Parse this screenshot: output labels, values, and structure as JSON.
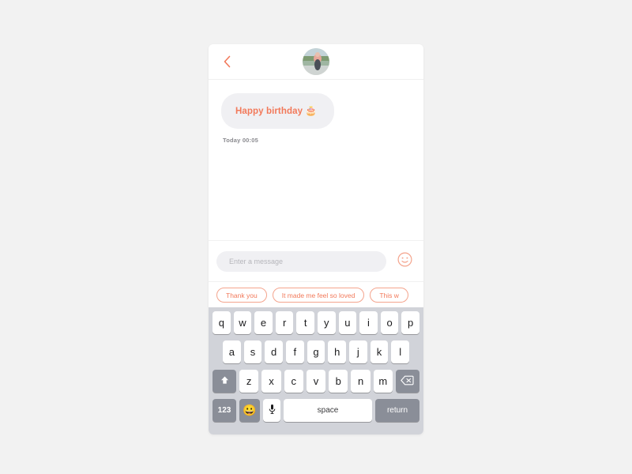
{
  "page": {
    "background_color": "#f2f2f2",
    "accent_color": "#f2795a"
  },
  "header": {
    "back_icon": "chevron-left-icon",
    "avatar_alt": "contact-avatar-photo"
  },
  "chat": {
    "messages": [
      {
        "text": "Happy birthday",
        "emoji": "🎂",
        "sender": "incoming",
        "bubble_color": "#f0f0f3",
        "text_color": "#f2795a"
      }
    ],
    "timestamp": "Today 00:05"
  },
  "input_bar": {
    "placeholder": "Enter a message",
    "value": "",
    "emoji_button_icon": "smiley-face-icon"
  },
  "suggestions": {
    "chips": [
      {
        "label": "Thank you"
      },
      {
        "label": "It made me feel so loved"
      },
      {
        "label": "This w"
      }
    ]
  },
  "keyboard": {
    "row1": [
      "q",
      "w",
      "e",
      "r",
      "t",
      "y",
      "u",
      "i",
      "o",
      "p"
    ],
    "row2": [
      "a",
      "s",
      "d",
      "f",
      "g",
      "h",
      "j",
      "k",
      "l"
    ],
    "row3": [
      "z",
      "x",
      "c",
      "v",
      "b",
      "n",
      "m"
    ],
    "shift_icon": "shift-arrow-icon",
    "backspace_icon": "backspace-delete-icon",
    "numbers_label": "123",
    "emoji_icon": "😀",
    "mic_icon": "microphone-icon",
    "space_label": "space",
    "return_label": "return"
  }
}
